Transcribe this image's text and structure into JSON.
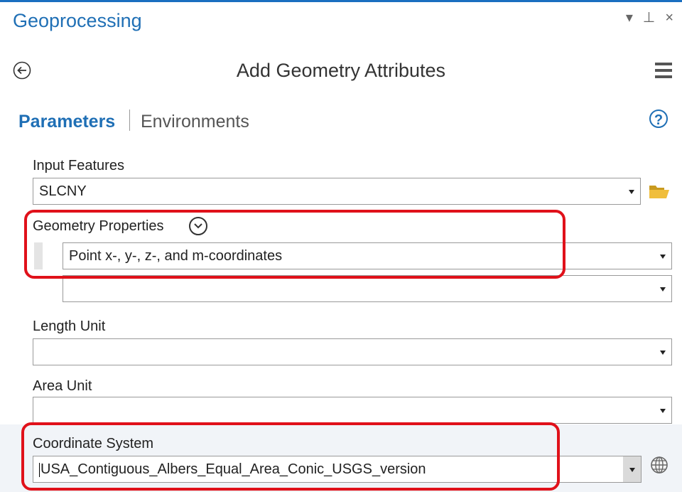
{
  "pane": {
    "title": "Geoprocessing",
    "controls": {
      "dropdown": "▾",
      "pin": "⊥",
      "close": "×"
    }
  },
  "tool": {
    "title": "Add Geometry Attributes"
  },
  "tabs": {
    "parameters": "Parameters",
    "environments": "Environments",
    "help": "?"
  },
  "params": {
    "input_features": {
      "label": "Input Features",
      "value": "SLCNY"
    },
    "geometry_properties": {
      "label": "Geometry Properties",
      "value": "Point x-, y-, z-, and m-coordinates",
      "second_value": ""
    },
    "length_unit": {
      "label": "Length Unit",
      "value": ""
    },
    "area_unit": {
      "label": "Area Unit",
      "value": ""
    },
    "coordinate_system": {
      "label": "Coordinate System",
      "value": "USA_Contiguous_Albers_Equal_Area_Conic_USGS_version"
    }
  },
  "colors": {
    "accent": "#1f6fb5",
    "highlight": "#e0111a"
  },
  "icons": [
    "back-arrow-icon",
    "hamburger-menu-icon",
    "help-icon",
    "folder-icon",
    "chevron-circle-icon",
    "globe-icon"
  ]
}
